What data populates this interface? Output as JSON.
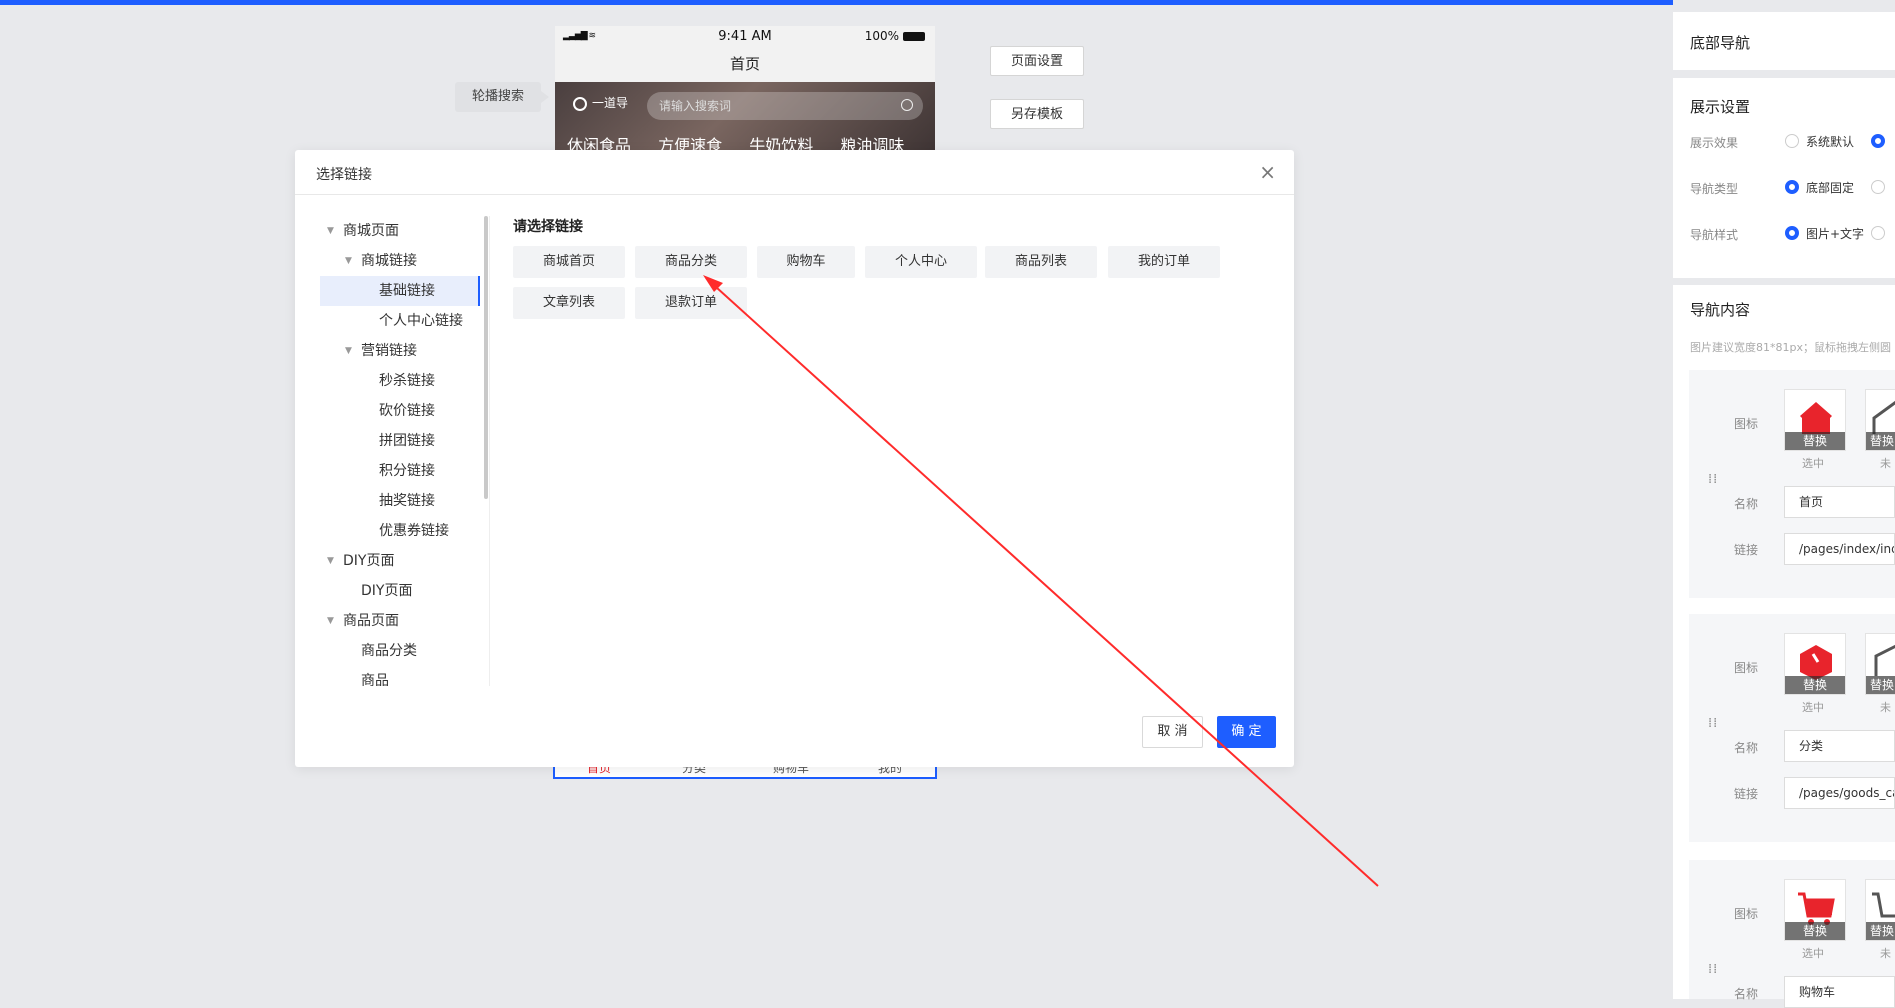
{
  "phone": {
    "time": "9:41 AM",
    "battery": "100%",
    "title": "首页",
    "logo_text": "一道导",
    "search_placeholder": "请输入搜索词",
    "categories": [
      "休闲食品",
      "方便速食",
      "牛奶饮料",
      "粮油调味"
    ],
    "bottom_tabs": [
      "首页",
      "分类",
      "购物车",
      "我的"
    ]
  },
  "canvas": {
    "carousel_search_label": "轮播搜索",
    "page_settings_button": "页面设置",
    "save_template_button": "另存模板"
  },
  "modal": {
    "title": "选择链接",
    "close": "×",
    "tree": [
      {
        "label": "商城页面",
        "level": 0,
        "caret": true
      },
      {
        "label": "商城链接",
        "level": 1,
        "caret": true
      },
      {
        "label": "基础链接",
        "level": 2,
        "active": true
      },
      {
        "label": "个人中心链接",
        "level": 2
      },
      {
        "label": "营销链接",
        "level": 1,
        "caret": true
      },
      {
        "label": "秒杀链接",
        "level": 2
      },
      {
        "label": "砍价链接",
        "level": 2
      },
      {
        "label": "拼团链接",
        "level": 2
      },
      {
        "label": "积分链接",
        "level": 2
      },
      {
        "label": "抽奖链接",
        "level": 2
      },
      {
        "label": "优惠券链接",
        "level": 2
      },
      {
        "label": "DIY页面",
        "level": 0,
        "caret": true
      },
      {
        "label": "DIY页面",
        "level": 1
      },
      {
        "label": "商品页面",
        "level": 0,
        "caret": true
      },
      {
        "label": "商品分类",
        "level": 1
      },
      {
        "label": "商品",
        "level": 1
      }
    ],
    "links_title": "请选择链接",
    "links": [
      "商城首页",
      "商品分类",
      "购物车",
      "个人中心",
      "商品列表",
      "我的订单",
      "文章列表",
      "退款订单"
    ],
    "cancel": "取 消",
    "confirm": "确 定"
  },
  "panel": {
    "title": "底部导航",
    "display_section": "展示设置",
    "display_effect_label": "展示效果",
    "display_effect_option": "系统默认",
    "nav_type_label": "导航类型",
    "nav_type_option": "底部固定",
    "nav_style_label": "导航样式",
    "nav_style_option": "图片+文字",
    "content_section": "导航内容",
    "content_hint": "图片建议宽度81*81px；鼠标拖拽左侧圆",
    "icon_label": "图标",
    "name_label": "名称",
    "link_label": "链接",
    "replace": "替换",
    "selected": "选中",
    "unselected": "未",
    "items": [
      {
        "name": "首页",
        "link": "/pages/index/index"
      },
      {
        "name": "分类",
        "link": "/pages/goods_cat"
      },
      {
        "name": "购物车",
        "link": ""
      }
    ],
    "accent": "#1e5eff",
    "icon_red": "#e8242c"
  }
}
